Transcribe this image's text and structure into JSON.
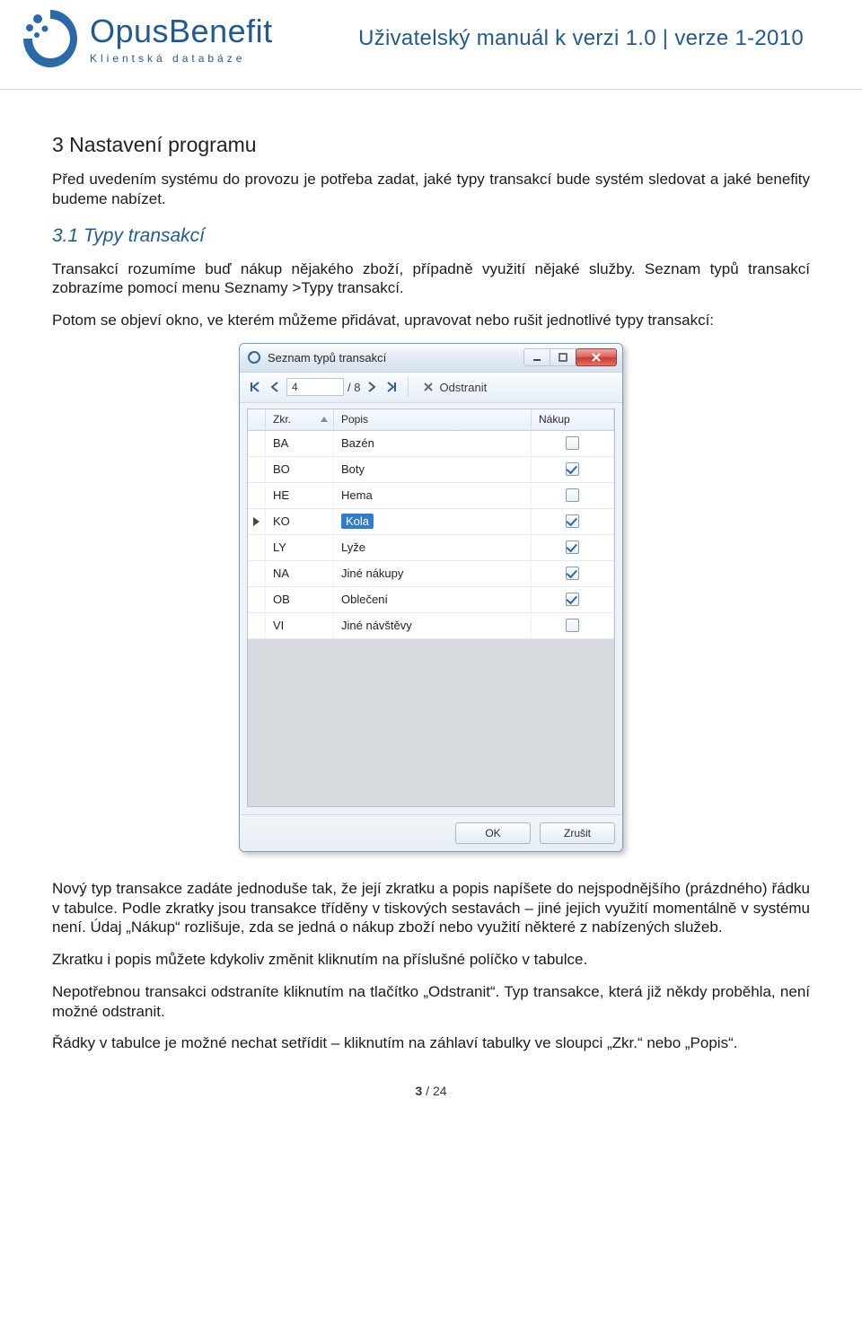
{
  "header": {
    "brand": "OpusBenefit",
    "tagline": "Klientská databáze",
    "right": "Uživatelský manuál k verzi 1.0 | verze 1-2010"
  },
  "section": {
    "heading": "3 Nastavení programu",
    "intro": "Před uvedením systému do provozu je potřeba zadat, jaké typy transakcí bude systém sledovat a jaké benefity budeme nabízet.",
    "sub_heading": "3.1 Typy transakcí",
    "para1": "Transakcí rozumíme buď nákup nějakého zboží, případně využití nějaké služby. Seznam typů transakcí zobrazíme pomocí menu Seznamy >Typy transakcí.",
    "para2": "Potom se objeví okno, ve kterém můžeme přidávat, upravovat nebo rušit jednotlivé typy transakcí:",
    "para3": "Nový typ transakce zadáte jednoduše tak, že její zkratku a popis napíšete do nejspodnějšího (prázdného) řádku v tabulce. Podle zkratky jsou transakce tříděny v tiskových sestavách – jiné jejich využití momentálně v systému není. Údaj „Nákup“ rozlišuje, zda se jedná o nákup zboží nebo využití některé z nabízených služeb.",
    "para4": "Zkratku i popis můžete kdykoliv změnit kliknutím na příslušné políčko v tabulce.",
    "para5": "Nepotřebnou transakci odstraníte kliknutím na tlačítko „Odstranit“. Typ transakce, která již někdy proběhla, není možné odstranit.",
    "para6": "Řádky v tabulce je možné nechat setřídit – kliknutím na záhlaví tabulky ve sloupci „Zkr.“ nebo „Popis“."
  },
  "window": {
    "title": "Seznam typů transakcí",
    "pager": {
      "current": "4",
      "total": "/ 8"
    },
    "remove_label": "Odstranit",
    "columns": {
      "zkr": "Zkr.",
      "popis": "Popis",
      "nakup": "Nákup"
    },
    "rows": [
      {
        "zkr": "BA",
        "popis": "Bazén",
        "nakup": false,
        "selected": false
      },
      {
        "zkr": "BO",
        "popis": "Boty",
        "nakup": true,
        "selected": false
      },
      {
        "zkr": "HE",
        "popis": "Hema",
        "nakup": false,
        "selected": false
      },
      {
        "zkr": "KO",
        "popis": "Kola",
        "nakup": true,
        "selected": true
      },
      {
        "zkr": "LY",
        "popis": "Lyže",
        "nakup": true,
        "selected": false
      },
      {
        "zkr": "NA",
        "popis": "Jiné nákupy",
        "nakup": true,
        "selected": false
      },
      {
        "zkr": "OB",
        "popis": "Oblečení",
        "nakup": true,
        "selected": false
      },
      {
        "zkr": "VI",
        "popis": "Jiné návštěvy",
        "nakup": false,
        "selected": false
      }
    ],
    "ok_label": "OK",
    "cancel_label": "Zrušit"
  },
  "page": {
    "current": "3",
    "total": "24",
    "sep": " / "
  }
}
